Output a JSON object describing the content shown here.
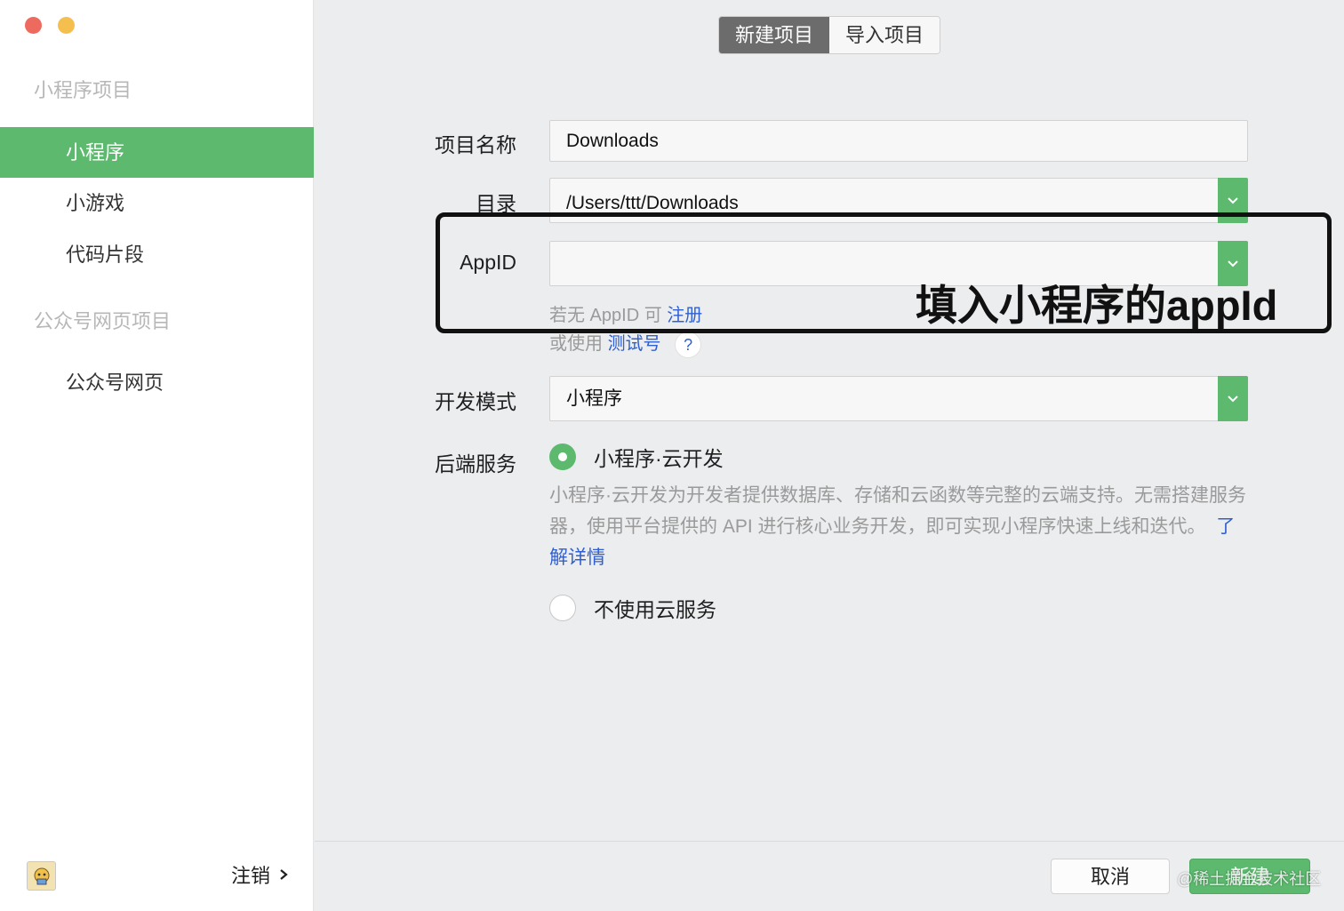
{
  "sidebar": {
    "section_mini": "小程序项目",
    "items_mini": [
      {
        "label": "小程序",
        "active": true
      },
      {
        "label": "小游戏",
        "active": false
      },
      {
        "label": "代码片段",
        "active": false
      }
    ],
    "section_official": "公众号网页项目",
    "items_official": [
      {
        "label": "公众号网页",
        "active": false
      }
    ],
    "logout_label": "注销",
    "logout_icon": "chevron-right-icon",
    "avatar_icon": "user-avatar-icon"
  },
  "tabs": [
    {
      "label": "新建项目",
      "selected": true
    },
    {
      "label": "导入项目",
      "selected": false
    }
  ],
  "form": {
    "project_name": {
      "label": "项目名称",
      "value": "Downloads"
    },
    "directory": {
      "label": "目录",
      "value": "/Users/ttt/Downloads"
    },
    "appid": {
      "label": "AppID",
      "value": ""
    },
    "appid_hint_prefix": "若无 AppID 可",
    "appid_register_link": "注册",
    "appid_alt_prefix": "或使用",
    "appid_test_link": "测试号",
    "help_symbol": "?",
    "dev_mode": {
      "label": "开发模式",
      "value": "小程序"
    },
    "backend": {
      "label": "后端服务",
      "option_cloud": "小程序·云开发",
      "option_cloud_selected": true,
      "desc": "小程序·云开发为开发者提供数据库、存储和云函数等完整的云端支持。无需搭建服务器，使用平台提供的 API 进行核心业务开发，即可实现小程序快速上线和迭代。",
      "learn_more_link": "了解详情",
      "option_none": "不使用云服务",
      "option_none_selected": false
    }
  },
  "annotation": {
    "text": "填入小程序的appId"
  },
  "footer": {
    "cancel_label": "取消",
    "create_label": "新建",
    "watermark": "@稀土掘金技术社区"
  },
  "colors": {
    "accent": "#5cb96e",
    "link": "#2f5fd1",
    "tab_selected": "#6c6c6c"
  }
}
